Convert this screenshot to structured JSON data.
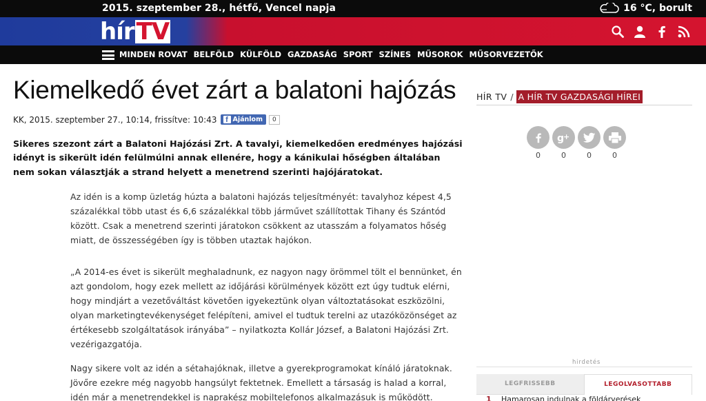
{
  "topbar": {
    "date": "2015. szeptember 28., hétfő, Vencel napja",
    "weather": "16 °C, borult",
    "weather_icon": "cloud-icon"
  },
  "brand": {
    "logo_part1": "hír",
    "logo_part2": "TV",
    "icons": [
      "search-icon",
      "user-icon",
      "facebook-icon",
      "rss-icon"
    ]
  },
  "nav": {
    "items": [
      "MINDEN ROVAT",
      "BELFÖLD",
      "KÜLFÖLD",
      "GAZDASÁG",
      "SPORT",
      "SZÍNES",
      "MŰSOROK",
      "MŰSORVEZETŐK"
    ]
  },
  "article": {
    "title": "Kiemelkedő évet zárt a balatoni hajózás",
    "meta": "KK, 2015. szeptember 27., 10:14, frissítve: 10:43",
    "fb_label": "Ajánlom",
    "fb_count": "0",
    "lead": "Sikeres szezont zárt a Balatoni Hajózási Zrt. A tavalyi, kiemelkedően eredményes hajózási idényt is sikerült idén felülmúlni annak ellenére, hogy a kánikulai hőségben általában nem sokan választják a strand helyett a menetrend szerinti hajójáratokat.",
    "p1": "Az idén is a komp üzletág húzta a balatoni hajózás teljesítményét: tavalyhoz képest 4,5 százalékkal több utast és 6,6 százalékkal több járművet szállítottak Tihany és Szántód között. Csak a menetrend szerinti járatokon csökkent az utasszám a folyamatos hőség miatt, de összességében így is többen utaztak hajókon.",
    "p2": "„A 2014-es évet is sikerült meghaladnunk, ez nagyon nagy örömmel tölt el bennünket, én azt gondolom, hogy ezek mellett az időjárási körülmények között ezt úgy tudtuk elérni, hogy mindjárt a vezetőváltást követően igyekeztünk olyan változtatásokat eszközölni, olyan marketingtevékenységet felépíteni, amivel el tudtuk terelni az utazóközönséget az értékesebb szolgáltatások irányába” – nyilatkozta Kollár József, a Balatoni Hajózási Zrt. vezérigazgatója.",
    "p3": "Nagy sikere volt az idén a sétahajóknak, illetve a gyerekprogramokat kínáló járatoknak. Jövőre ezekre még nagyobb hangsúlyt fektetnek. Emellett a társaság is halad a korral, idén már a menetrendekkel is naprakész mobiltelefonos alkalmazásuk is működött."
  },
  "sidebar": {
    "crumb_home": "HÍR TV",
    "crumb_sep": "/",
    "crumb_section": "A HÍR TV GAZDASÁGI HÍREI",
    "shares": [
      {
        "icon": "facebook-share-icon",
        "count": "0"
      },
      {
        "icon": "googleplus-share-icon",
        "count": "0"
      },
      {
        "icon": "twitter-share-icon",
        "count": "0"
      },
      {
        "icon": "print-icon",
        "count": "0"
      }
    ],
    "ad_label": "hirdetés",
    "tab_latest": "LEGFRISSEBB",
    "tab_most_read": "LEGOLVASOTTABB",
    "list": [
      {
        "num": "1",
        "title": "Hamarosan indulnak a földárverések"
      }
    ]
  }
}
